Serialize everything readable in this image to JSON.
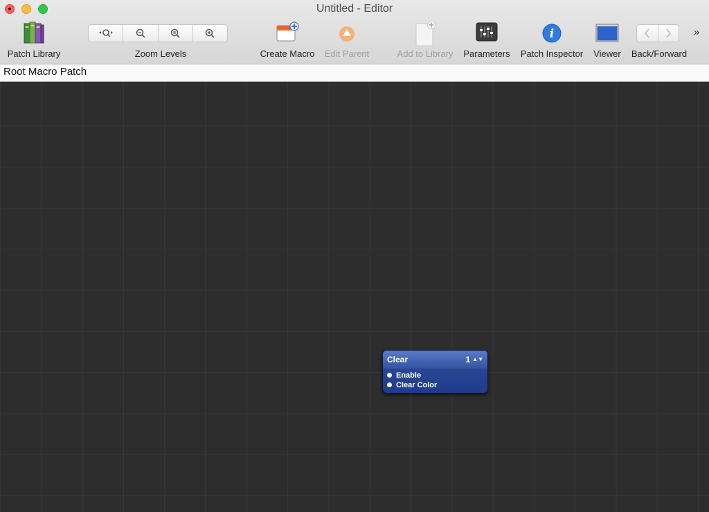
{
  "window": {
    "title": "Untitled - Editor"
  },
  "toolbar": {
    "patch_library": "Patch Library",
    "zoom_levels": "Zoom Levels",
    "create_macro": "Create Macro",
    "edit_parent": "Edit Parent",
    "add_to_library": "Add to Library",
    "parameters": "Parameters",
    "patch_inspector": "Patch Inspector",
    "viewer": "Viewer",
    "back_forward": "Back/Forward",
    "overflow": "»",
    "edit_parent_enabled": false,
    "add_to_library_enabled": false
  },
  "breadcrumb": {
    "path": "Root Macro Patch"
  },
  "canvas": {
    "background_color": "#2d2d2d",
    "patches": [
      {
        "title": "Clear",
        "execution_order": "1",
        "color": "#2f4fa0",
        "inputs": [
          "Enable",
          "Clear Color"
        ]
      }
    ]
  }
}
